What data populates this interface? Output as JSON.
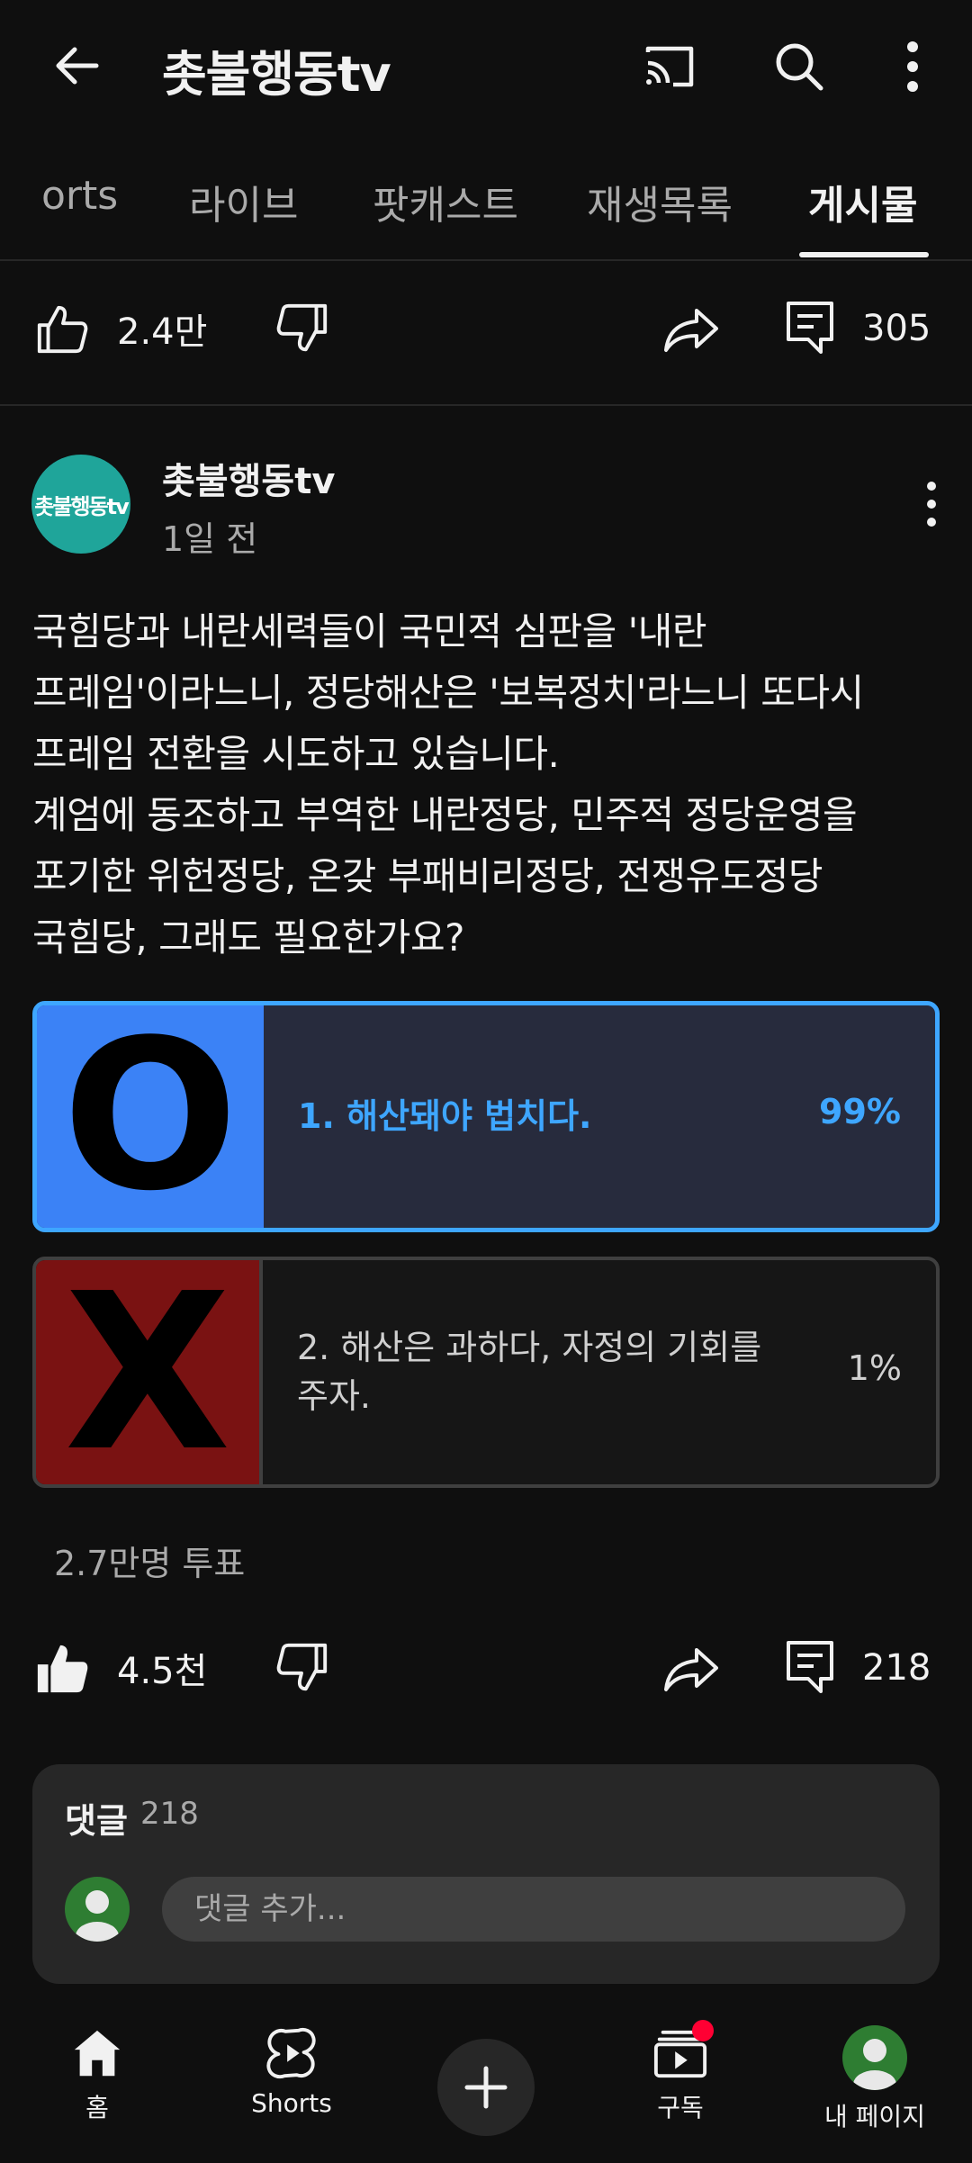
{
  "header": {
    "channel_title": "촛불행동tv",
    "back_icon": "arrow-left-icon",
    "cast_icon": "cast-icon",
    "search_icon": "search-icon",
    "more_icon": "more-vertical-icon"
  },
  "tabs": [
    {
      "label": "orts"
    },
    {
      "label": "라이브"
    },
    {
      "label": "팟캐스트"
    },
    {
      "label": "재생목록"
    },
    {
      "label": "게시물",
      "active": true
    }
  ],
  "top_actions": {
    "like_count": "2.4만",
    "comment_count": "305"
  },
  "post": {
    "author": "촛불행동tv",
    "avatar_text": "촛불행동tv",
    "time": "1일 전",
    "lines": [
      "국힘당과 내란세력들이 국민적 심판을 '내란",
      "프레임'이라느니, 정당해산은 '보복정치'라느니 또다시",
      "프레임 전환을 시도하고 있습니다.",
      "계엄에 동조하고 부역한 내란정당, 민주적 정당운영을",
      "포기한 위헌정당, 온갖 부패비리정당, 전쟁유도정당",
      "국힘당, 그래도 필요한가요?"
    ],
    "poll": {
      "options": [
        {
          "label": "1. 해산돼야 법치다.",
          "percent": "99%",
          "selected": true,
          "thumb_symbol": "O"
        },
        {
          "label_line1": "2. 해산은 과하다, 자정의 기회를",
          "label_line2": "주자.",
          "percent": "1%",
          "selected": false,
          "thumb_symbol": "X"
        }
      ],
      "votes": "2.7만명 투표"
    },
    "actions": {
      "like_count": "4.5천",
      "comment_count": "218"
    }
  },
  "comments": {
    "title": "댓글",
    "count": "218",
    "placeholder": "댓글 추가..."
  },
  "bottom_nav": {
    "home": "홈",
    "shorts": "Shorts",
    "subscriptions": "구독",
    "me": "내 페이지"
  },
  "colors": {
    "background": "#0f0f0f",
    "accent_blue": "#3ea6ff",
    "poll_o_bg": "#3b82f6",
    "poll_x_bg": "#7a1212",
    "avatar_teal": "#1fa59a",
    "notification_red": "#ff0033"
  }
}
